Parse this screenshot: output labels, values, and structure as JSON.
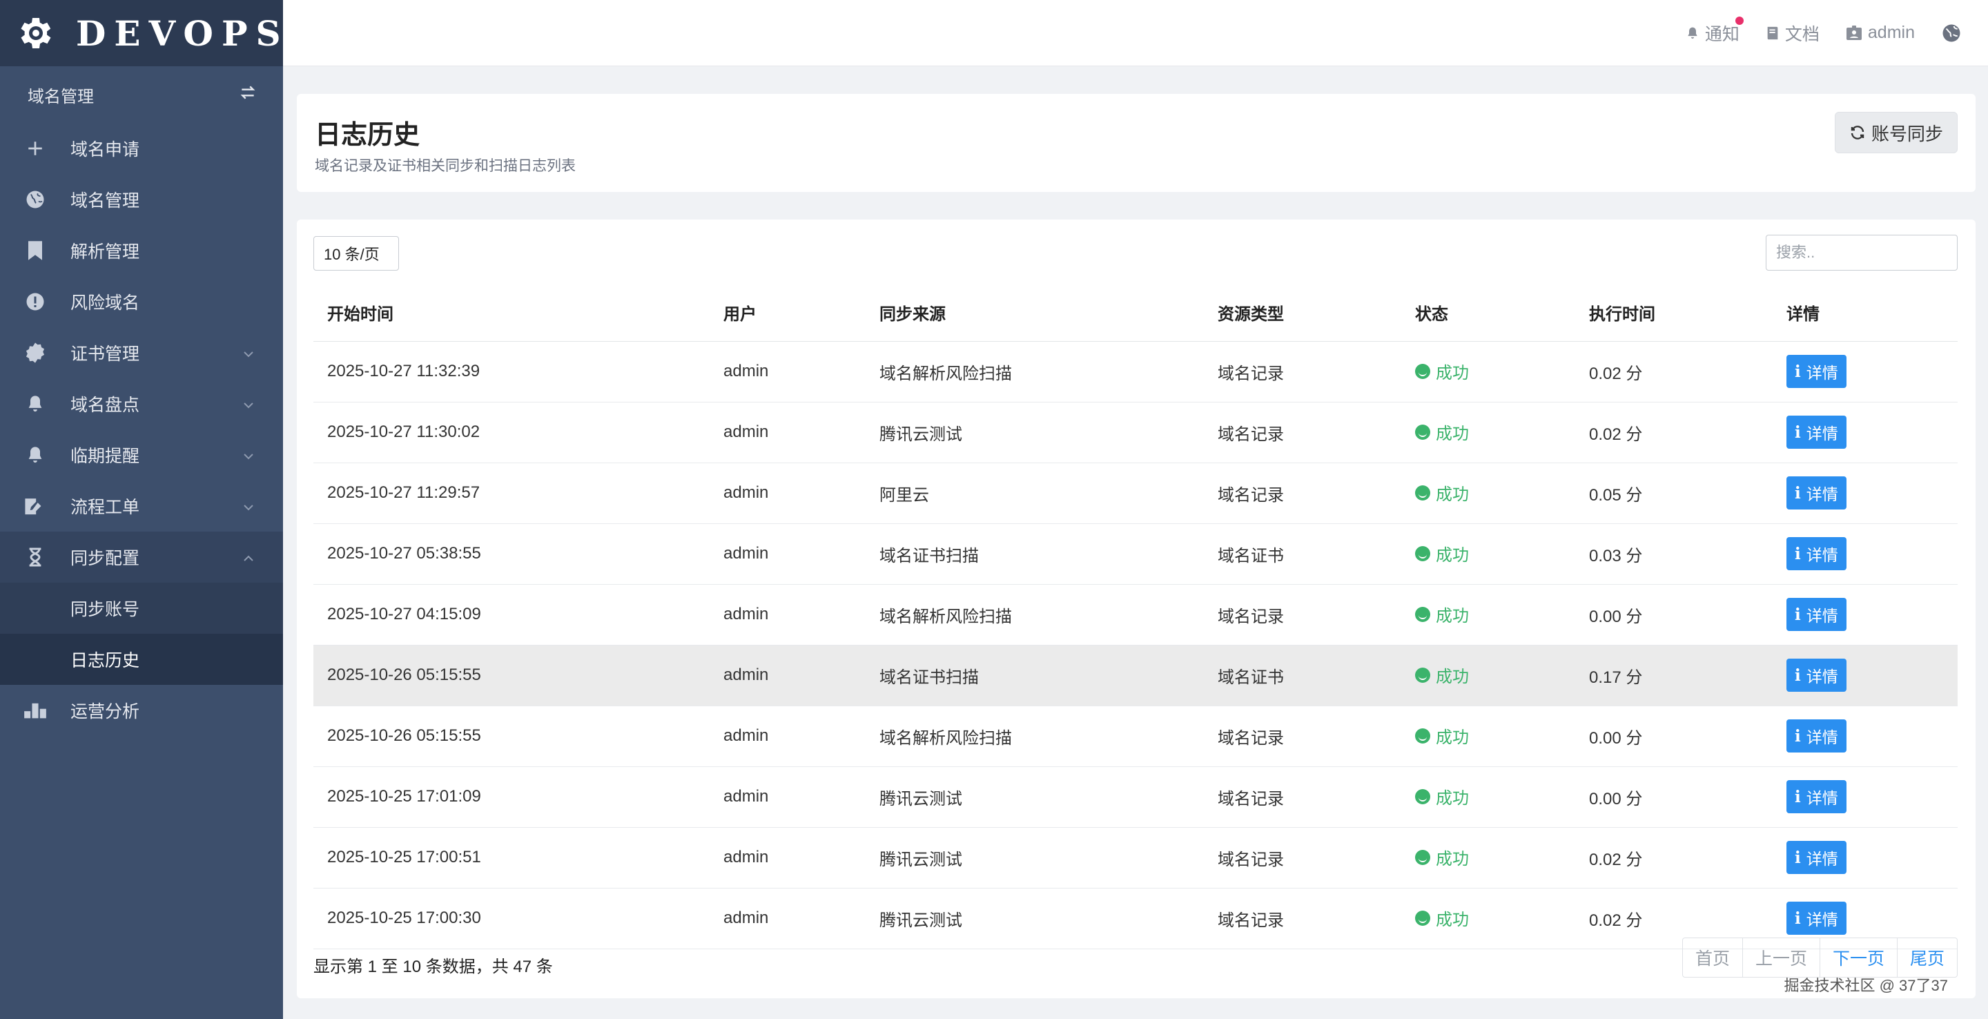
{
  "brand": {
    "name": "DEVOPS"
  },
  "topbar": {
    "notify": "通知",
    "docs": "文档",
    "user": "admin"
  },
  "sidebar": {
    "section": "域名管理",
    "items": [
      {
        "label": "域名申请",
        "icon": "plus-icon"
      },
      {
        "label": "域名管理",
        "icon": "globe-icon"
      },
      {
        "label": "解析管理",
        "icon": "bookmark-icon"
      },
      {
        "label": "风险域名",
        "icon": "alert-circle-icon"
      },
      {
        "label": "证书管理",
        "icon": "certificate-icon"
      },
      {
        "label": "域名盘点",
        "icon": "bell-icon"
      },
      {
        "label": "临期提醒",
        "icon": "bell-icon"
      },
      {
        "label": "流程工单",
        "icon": "signature-icon"
      },
      {
        "label": "同步配置",
        "icon": "hourglass-icon"
      },
      {
        "label": "运营分析",
        "icon": "chart-icon"
      }
    ],
    "sub_items": [
      {
        "label": "同步账号"
      },
      {
        "label": "日志历史"
      }
    ]
  },
  "header": {
    "title": "日志历史",
    "subtitle": "域名记录及证书相关同步和扫描日志列表",
    "sync_button": "账号同步"
  },
  "table": {
    "per_page": "10 条/页",
    "search_placeholder": "搜索..",
    "columns": [
      "开始时间",
      "用户",
      "同步来源",
      "资源类型",
      "状态",
      "执行时间",
      "详情"
    ],
    "rows": [
      {
        "time": "2025-10-27 11:32:39",
        "user": "admin",
        "source": "域名解析风险扫描",
        "type": "域名记录",
        "status": "成功",
        "duration": "0.02 分",
        "detail": "详情"
      },
      {
        "time": "2025-10-27 11:30:02",
        "user": "admin",
        "source": "腾讯云测试",
        "type": "域名记录",
        "status": "成功",
        "duration": "0.02 分",
        "detail": "详情"
      },
      {
        "time": "2025-10-27 11:29:57",
        "user": "admin",
        "source": "阿里云",
        "type": "域名记录",
        "status": "成功",
        "duration": "0.05 分",
        "detail": "详情"
      },
      {
        "time": "2025-10-27 05:38:55",
        "user": "admin",
        "source": "域名证书扫描",
        "type": "域名证书",
        "status": "成功",
        "duration": "0.03 分",
        "detail": "详情"
      },
      {
        "time": "2025-10-27 04:15:09",
        "user": "admin",
        "source": "域名解析风险扫描",
        "type": "域名记录",
        "status": "成功",
        "duration": "0.00 分",
        "detail": "详情"
      },
      {
        "time": "2025-10-26 05:15:55",
        "user": "admin",
        "source": "域名证书扫描",
        "type": "域名证书",
        "status": "成功",
        "duration": "0.17 分",
        "detail": "详情"
      },
      {
        "time": "2025-10-26 05:15:55",
        "user": "admin",
        "source": "域名解析风险扫描",
        "type": "域名记录",
        "status": "成功",
        "duration": "0.00 分",
        "detail": "详情"
      },
      {
        "time": "2025-10-25 17:01:09",
        "user": "admin",
        "source": "腾讯云测试",
        "type": "域名记录",
        "status": "成功",
        "duration": "0.00 分",
        "detail": "详情"
      },
      {
        "time": "2025-10-25 17:00:51",
        "user": "admin",
        "source": "腾讯云测试",
        "type": "域名记录",
        "status": "成功",
        "duration": "0.02 分",
        "detail": "详情"
      },
      {
        "time": "2025-10-25 17:00:30",
        "user": "admin",
        "source": "腾讯云测试",
        "type": "域名记录",
        "status": "成功",
        "duration": "0.02 分",
        "detail": "详情"
      }
    ],
    "info": "显示第 1 至 10 条数据，共 47 条"
  },
  "pager": {
    "first": "首页",
    "prev": "上一页",
    "next": "下一页",
    "last": "尾页"
  },
  "footer": {
    "credit": "掘金技术社区 @ 37了37"
  },
  "colors": {
    "sidebar": "#3d4f6c",
    "accent": "#2b8ff0",
    "success": "#3bb36b"
  }
}
